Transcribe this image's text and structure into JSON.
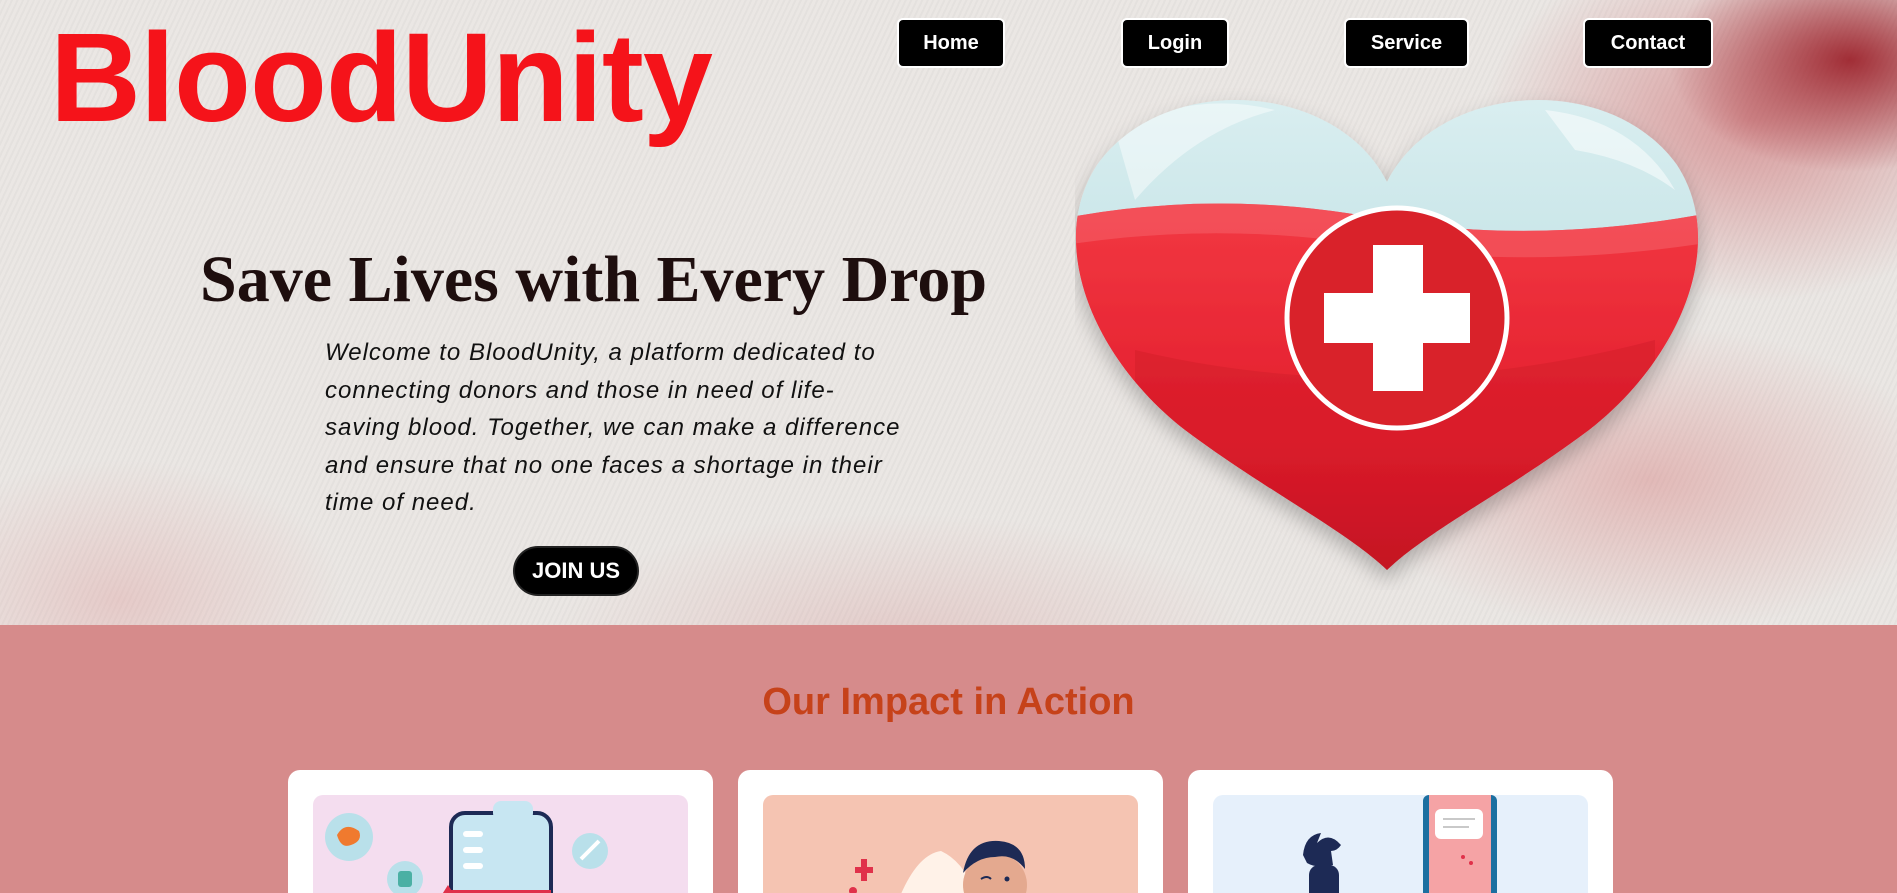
{
  "brand": {
    "name": "BloodUnity",
    "color": "#f5131a"
  },
  "nav": {
    "home": "Home",
    "login": "Login",
    "service": "Service",
    "contact": "Contact"
  },
  "hero": {
    "headline": "Save Lives with Every Drop",
    "intro": "Welcome to BloodUnity, a platform dedicated to connecting donors and those in need of life-saving blood. Together, we can make a difference and ensure that no one faces a shortage in their time of need.",
    "cta": "JOIN US",
    "illustration": "heart-blood-bag-medical-cross"
  },
  "impact": {
    "title": "Our Impact in Action",
    "title_color": "#c6421a",
    "background": "#d68b8b",
    "cards": [
      {
        "illustration": "blood-bag-organs-icons",
        "bg": "#f4ddef"
      },
      {
        "illustration": "donor-with-blood-drop",
        "bg": "#f5c4b2"
      },
      {
        "illustration": "person-with-phone-notification",
        "bg": "#e6f0fb"
      }
    ]
  }
}
